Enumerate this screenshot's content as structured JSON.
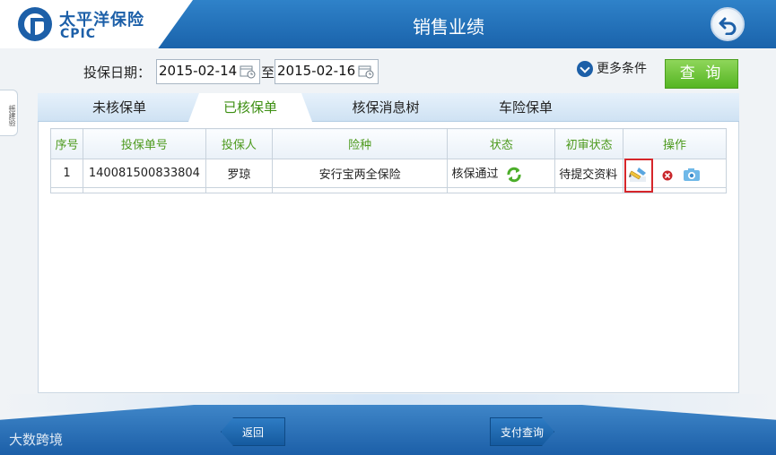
{
  "header": {
    "brand_cn": "太平洋保险",
    "brand_en": "CPIC",
    "title": "销售业绩",
    "back_icon": "undo-arrow-icon"
  },
  "side_tab": {
    "label": "摇建验"
  },
  "filter": {
    "date_label": "投保日期：",
    "date_from": "2015-02-14",
    "date_sep": "至",
    "date_to": "2015-02-16",
    "more_conditions": "更多条件",
    "query_label": "查 询"
  },
  "tabs": [
    {
      "label": "未核保单"
    },
    {
      "label": "已核保单",
      "active": true
    },
    {
      "label": "核保消息树"
    },
    {
      "label": "车险保单"
    }
  ],
  "table": {
    "headers": [
      "序号",
      "投保单号",
      "投保人",
      "险种",
      "状态",
      "初审状态",
      "操作"
    ],
    "rows": [
      {
        "index": "1",
        "policy_no": "140081500833804",
        "holder": "罗琼",
        "product": "安行宝两全保险",
        "status": "核保通过",
        "first_review": "待提交资料"
      }
    ]
  },
  "footer": {
    "back_label": "返回",
    "pay_query_label": "支付查询",
    "watermark": "大数跨境"
  },
  "colors": {
    "brand_blue": "#1c5fa8",
    "accent_green": "#55b523",
    "highlight_red": "#d6262b"
  }
}
